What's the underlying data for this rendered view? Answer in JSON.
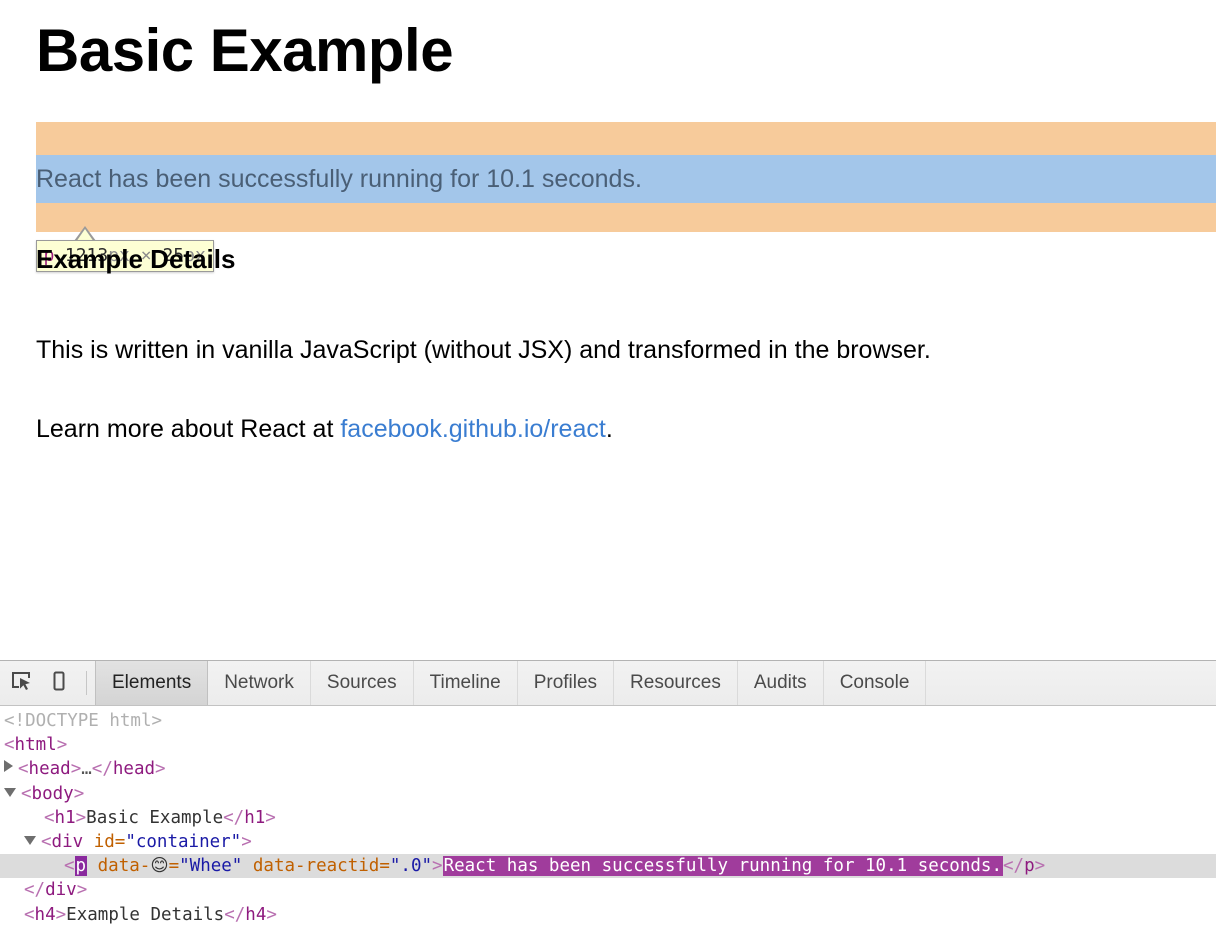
{
  "page": {
    "title": "Basic Example",
    "subtitle": "Example Details",
    "highlight_text": "React has been successfully running for 10.1 seconds.",
    "paragraph_1": "This is written in vanilla JavaScript (without JSX) and transformed in the browser.",
    "paragraph_2_prefix": "Learn more about React at ",
    "link_text": "facebook.github.io/react",
    "paragraph_2_suffix": "."
  },
  "inspector_tooltip": {
    "tag": "p",
    "width": "1213",
    "width_unit": "px",
    "separator": "×",
    "height": "25",
    "height_unit": "px"
  },
  "highlight_colors": {
    "padding_box": "#f7cb9b",
    "content_box": "#a3c6ea",
    "tooltip_background": "#fdffd4",
    "tooltip_border": "#9a9a9a"
  },
  "devtools": {
    "icons": {
      "inspect": "inspect-element-icon",
      "device": "device-toolbar-icon"
    },
    "tabs": [
      {
        "label": "Elements",
        "active": true
      },
      {
        "label": "Network",
        "active": false
      },
      {
        "label": "Sources",
        "active": false
      },
      {
        "label": "Timeline",
        "active": false
      },
      {
        "label": "Profiles",
        "active": false
      },
      {
        "label": "Resources",
        "active": false
      },
      {
        "label": "Audits",
        "active": false
      },
      {
        "label": "Console",
        "active": false
      }
    ],
    "dom": {
      "doctype": "<!DOCTYPE html>",
      "html_open_lb": "<",
      "html_tag": "html",
      "html_open_rb": ">",
      "head_lb": "<",
      "head_tag": "head",
      "head_rb": ">",
      "head_ellipsis": "…",
      "head_close_lb": "</",
      "head_close_tag": "head",
      "head_close_rb": ">",
      "body_lb": "<",
      "body_tag": "body",
      "body_rb": ">",
      "h1_open_lb": "<",
      "h1_open_tag": "h1",
      "h1_open_rb": ">",
      "h1_text": "Basic Example",
      "h1_close_lb": "</",
      "h1_close_tag": "h1",
      "h1_close_rb": ">",
      "div_lb": "<",
      "div_tag": "div",
      "div_attr_name": "id",
      "div_attr_eq": "=",
      "div_attr_value": "\"container\"",
      "div_rb": ">",
      "p_lb": "<",
      "p_tag": "p",
      "p_attr1_name": "data-",
      "p_attr1_emoji": "😊",
      "p_attr1_eq": "=",
      "p_attr1_value": "\"Whee\"",
      "p_attr2_name": "data-reactid",
      "p_attr2_eq": "=",
      "p_attr2_value": "\".0\"",
      "p_rb": ">",
      "p_text": "React has been successfully running for 10.1 seconds.",
      "p_close_lb": "</",
      "p_close_tag": "p",
      "p_close_rb": ">",
      "div_close_lb": "</",
      "div_close_tag": "div",
      "div_close_rb": ">",
      "h4_open_lb": "<",
      "h4_open_tag": "h4",
      "h4_open_rb": ">",
      "h4_text": "Example Details",
      "h4_close_lb": "</",
      "h4_close_tag": "h4",
      "h4_close_rb": ">"
    }
  }
}
